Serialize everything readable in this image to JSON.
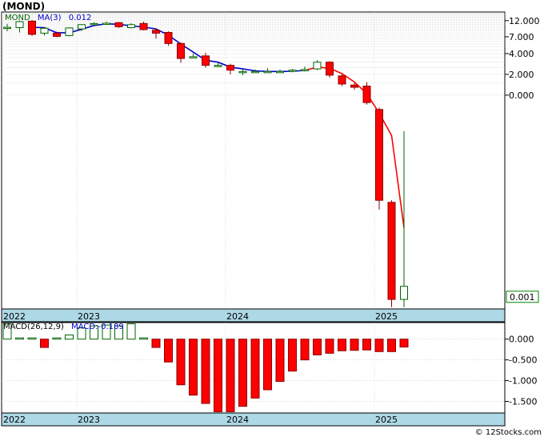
{
  "page": {
    "title": "(MOND)",
    "watermark": "© 12Stocks.com"
  },
  "chart_data": [
    {
      "type": "candlestick",
      "name": "price-panel",
      "scale": "log",
      "legend": {
        "ticker": "MOND",
        "ma_label": "MA(3)",
        "ma_value": "0.012"
      },
      "y_ticks": [
        {
          "v": 12,
          "label": "12.000"
        },
        {
          "v": 7,
          "label": "7.000"
        },
        {
          "v": 4,
          "label": "4.000"
        },
        {
          "v": 2,
          "label": "2.000"
        },
        {
          "v": 1,
          "label": "0.000"
        }
      ],
      "last_price_label": "0.001",
      "last_price_value": 0.0012,
      "ylim": [
        0.0008,
        16
      ],
      "x_labels": [
        {
          "i": 0,
          "label": "2022"
        },
        {
          "i": 6,
          "label": "2023"
        },
        {
          "i": 18,
          "label": "2024"
        },
        {
          "i": 30,
          "label": "2025"
        }
      ],
      "candles": [
        {
          "o": 9.6,
          "h": 10.8,
          "l": 8.4,
          "c": 9.6
        },
        {
          "o": 9.5,
          "h": 12.0,
          "l": 8.1,
          "c": 11.6
        },
        {
          "o": 11.8,
          "h": 12.2,
          "l": 7.2,
          "c": 7.6
        },
        {
          "o": 7.9,
          "h": 9.6,
          "l": 7.3,
          "c": 9.3
        },
        {
          "o": 7.9,
          "h": 8.3,
          "l": 6.9,
          "c": 7.1
        },
        {
          "o": 7.3,
          "h": 9.6,
          "l": 7.1,
          "c": 9.4
        },
        {
          "o": 9.1,
          "h": 10.7,
          "l": 8.5,
          "c": 10.5
        },
        {
          "o": 10.9,
          "h": 11.4,
          "l": 10.3,
          "c": 10.9
        },
        {
          "o": 10.8,
          "h": 11.6,
          "l": 10.5,
          "c": 11.0
        },
        {
          "o": 11.2,
          "h": 11.5,
          "l": 9.4,
          "c": 9.8
        },
        {
          "o": 9.5,
          "h": 11.0,
          "l": 9.3,
          "c": 10.5
        },
        {
          "o": 10.9,
          "h": 11.6,
          "l": 8.7,
          "c": 8.9
        },
        {
          "o": 8.7,
          "h": 9.3,
          "l": 6.6,
          "c": 7.9
        },
        {
          "o": 8.1,
          "h": 8.4,
          "l": 5.2,
          "c": 5.6
        },
        {
          "o": 5.6,
          "h": 5.8,
          "l": 2.95,
          "c": 3.4
        },
        {
          "o": 3.6,
          "h": 4.0,
          "l": 3.5,
          "c": 3.6
        },
        {
          "o": 3.7,
          "h": 4.1,
          "l": 2.5,
          "c": 2.7
        },
        {
          "o": 2.7,
          "h": 3.0,
          "l": 2.55,
          "c": 2.7
        },
        {
          "o": 2.7,
          "h": 2.85,
          "l": 2.0,
          "c": 2.3
        },
        {
          "o": 2.2,
          "h": 2.4,
          "l": 1.95,
          "c": 2.2
        },
        {
          "o": 2.2,
          "h": 2.35,
          "l": 2.15,
          "c": 2.2
        },
        {
          "o": 2.2,
          "h": 2.45,
          "l": 2.2,
          "c": 2.2
        },
        {
          "o": 2.2,
          "h": 2.35,
          "l": 2.15,
          "c": 2.2
        },
        {
          "o": 2.25,
          "h": 2.4,
          "l": 2.15,
          "c": 2.3
        },
        {
          "o": 2.3,
          "h": 2.6,
          "l": 2.2,
          "c": 2.35
        },
        {
          "o": 2.4,
          "h": 3.2,
          "l": 2.3,
          "c": 3.0
        },
        {
          "o": 3.0,
          "h": 3.1,
          "l": 1.8,
          "c": 1.95
        },
        {
          "o": 1.9,
          "h": 2.0,
          "l": 1.35,
          "c": 1.45
        },
        {
          "o": 1.4,
          "h": 1.5,
          "l": 1.2,
          "c": 1.3
        },
        {
          "o": 1.35,
          "h": 1.55,
          "l": 0.73,
          "c": 0.78
        },
        {
          "o": 0.62,
          "h": 0.66,
          "l": 0.022,
          "c": 0.03
        },
        {
          "o": 0.028,
          "h": 0.03,
          "l": 0.00085,
          "c": 0.0011
        },
        {
          "o": 0.0011,
          "h": 0.3,
          "l": 0.00085,
          "c": 0.0017
        }
      ],
      "ma": [
        null,
        null,
        9.6,
        9.5,
        8.0,
        8.0,
        9.0,
        10.2,
        10.8,
        10.6,
        10.1,
        9.7,
        9.1,
        7.4,
        5.5,
        4.2,
        3.2,
        3.0,
        2.55,
        2.4,
        2.25,
        2.2,
        2.2,
        2.22,
        2.28,
        2.55,
        2.45,
        2.05,
        1.55,
        1.05,
        0.55,
        0.26,
        0.012
      ]
    },
    {
      "type": "bar",
      "name": "macd-panel",
      "legend": {
        "label": "MACD(26,12,9)",
        "value_label": "MACD:-0.189"
      },
      "y_ticks": [
        {
          "v": 0,
          "label": "0.000"
        },
        {
          "v": -0.5,
          "label": "-0.500"
        },
        {
          "v": -1.0,
          "label": "-1.000"
        },
        {
          "v": -1.5,
          "label": "-1.500"
        }
      ],
      "ylim": [
        -1.78,
        0.4
      ],
      "x_labels": [
        {
          "i": 0,
          "label": "2022"
        },
        {
          "i": 6,
          "label": "2023"
        },
        {
          "i": 18,
          "label": "2024"
        },
        {
          "i": 30,
          "label": "2025"
        }
      ],
      "values": [
        0.37,
        0.03,
        0.03,
        -0.2,
        0.03,
        0.1,
        0.27,
        0.32,
        0.34,
        0.32,
        0.37,
        0.03,
        -0.2,
        -0.55,
        -1.1,
        -1.35,
        -1.55,
        -1.75,
        -1.75,
        -1.62,
        -1.42,
        -1.22,
        -1.02,
        -0.77,
        -0.5,
        -0.38,
        -0.34,
        -0.28,
        -0.27,
        -0.26,
        -0.3,
        -0.3,
        -0.19
      ]
    }
  ],
  "colors": {
    "up_fill": "#ffffff",
    "up_stroke": "#006400",
    "down_fill": "#ff0000",
    "down_stroke": "#8b0000",
    "ma_early": "#0000cc",
    "ma_late": "#ff0000",
    "axis_band": "#add8e6",
    "grid": "#c8c8c8",
    "price_box_fill": "#ffffff",
    "price_box_stroke": "#008000",
    "legend_ticker": "#006400",
    "legend_ma": "#0000cc",
    "macd_label": "#000000",
    "macd_value": "#0000cc"
  }
}
